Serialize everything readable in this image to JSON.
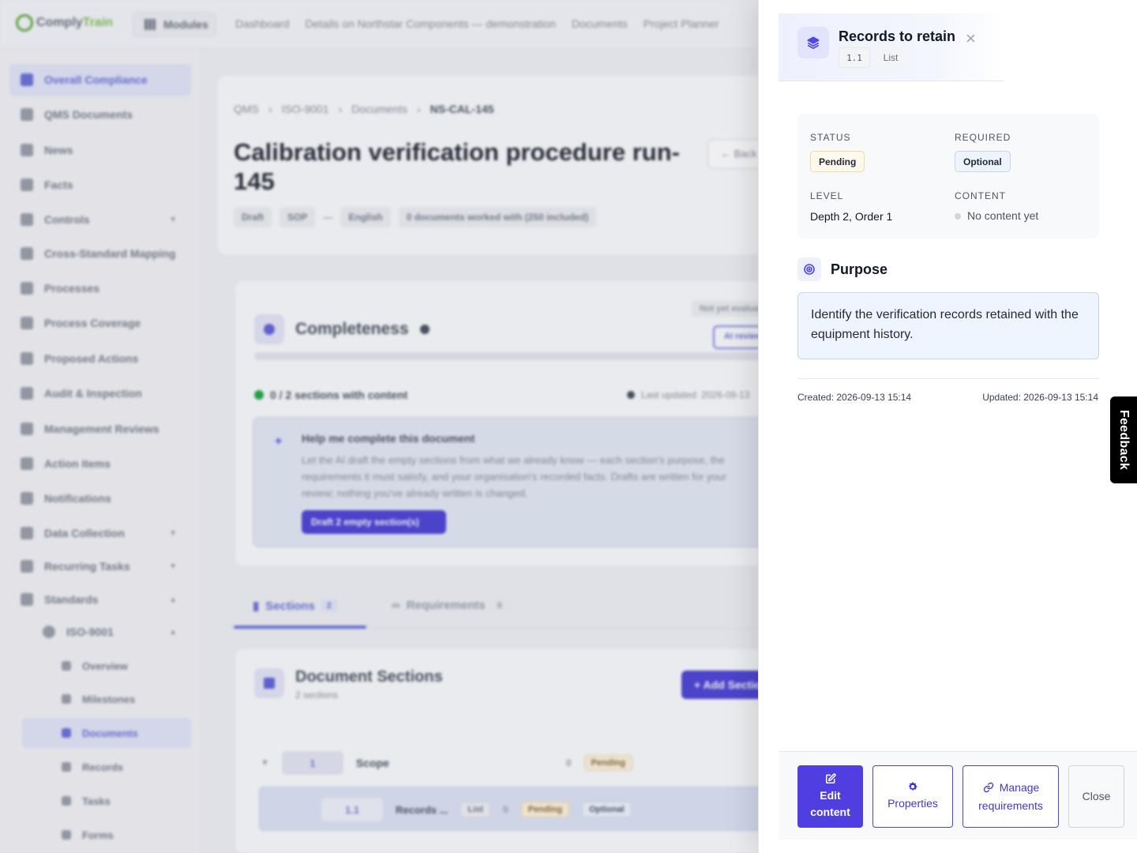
{
  "app": {
    "logo": {
      "part1": "Comply",
      "part2": "Train"
    },
    "modules_label": "Modules",
    "top_nav": [
      "Dashboard",
      "Details on Northstar Components — demonstration",
      "Documents",
      "Project Planner"
    ]
  },
  "sidebar": {
    "items": [
      {
        "label": "Overall Compliance",
        "icon": "compliance-icon",
        "active": true
      },
      {
        "label": "QMS Documents",
        "icon": "document-icon"
      },
      {
        "label": "News",
        "icon": "megaphone-icon"
      },
      {
        "label": "Facts",
        "icon": "lightbulb-icon"
      },
      {
        "label": "Controls",
        "icon": "shield-icon",
        "expandable": true
      },
      {
        "label": "Cross-Standard Mapping",
        "icon": "table-icon"
      },
      {
        "label": "Processes",
        "icon": "flow-icon"
      },
      {
        "label": "Process Coverage",
        "icon": "grid-icon"
      },
      {
        "label": "Proposed Actions",
        "icon": "list-icon"
      },
      {
        "label": "Audit & Inspection",
        "icon": "clipboard-icon"
      },
      {
        "label": "Management Reviews",
        "icon": "chat-icon"
      },
      {
        "label": "Action Items",
        "icon": "checklist-icon"
      },
      {
        "label": "Notifications",
        "icon": "bell-icon"
      },
      {
        "label": "Data Collection",
        "icon": "database-icon",
        "expandable": true
      },
      {
        "label": "Recurring Tasks",
        "icon": "repeat-icon",
        "expandable": true
      },
      {
        "label": "Standards",
        "icon": "book-icon",
        "expanded": true
      }
    ],
    "standard": {
      "label": "ISO-9001",
      "icon": "badge-icon"
    },
    "standard_children": [
      {
        "label": "Overview",
        "icon": "overview-icon"
      },
      {
        "label": "Milestones",
        "icon": "flag-icon"
      },
      {
        "label": "Documents",
        "icon": "folder-icon",
        "active": true
      },
      {
        "label": "Records",
        "icon": "record-icon"
      },
      {
        "label": "Tasks",
        "icon": "task-icon"
      },
      {
        "label": "Forms",
        "icon": "form-icon"
      }
    ]
  },
  "document": {
    "breadcrumb": [
      "QMS",
      "ISO-9001",
      "Documents",
      "NS-CAL-145"
    ],
    "title": "Calibration verification procedure run-145",
    "back_label": "Back",
    "chips": [
      "Draft",
      "SOP",
      "—",
      "English",
      "0 documents worked with (250 included)"
    ]
  },
  "completeness": {
    "title": "Completeness",
    "status": "Not yet evaluated",
    "ai_button": "AI review",
    "sections_with_content": "0 / 2 sections with content",
    "last_updated": "Last updated: 2026-09-13",
    "help_title": "Help me complete this document",
    "help_text": "Let the AI draft the empty sections from what we already know — each section's purpose, the requirements it must satisfy, and your organisation's recorded facts. Drafts are written for your review; nothing you've already written is changed.",
    "draft_button": "Draft 2 empty section(s)"
  },
  "tabs": [
    {
      "label": "Sections",
      "count": "2",
      "active": true
    },
    {
      "label": "Requirements",
      "count": "0"
    }
  ],
  "doc_sections": {
    "title": "Document Sections",
    "subtitle": "2 sections",
    "add_button": "Add Section",
    "rows": [
      {
        "num": "1",
        "title": "Scope",
        "count": "0",
        "status": "Pending"
      },
      {
        "num": "1.1",
        "title": "Records ...",
        "type": "List",
        "count": "0",
        "status": "Pending",
        "required": "Optional"
      }
    ]
  },
  "drawer": {
    "title": "Records to retain",
    "number": "1.1",
    "type": "List",
    "close_icon": "×",
    "meta": {
      "status_label": "STATUS",
      "status": "Pending",
      "required_label": "REQUIRED",
      "required": "Optional",
      "level_label": "LEVEL",
      "level": "Depth 2, Order 1",
      "content_label": "CONTENT",
      "content": "No content yet"
    },
    "purpose_title": "Purpose",
    "purpose_text": "Identify the verification records retained with the equipment history.",
    "created": "Created: 2026-09-13 15:14",
    "updated": "Updated: 2026-09-13 15:14",
    "buttons": {
      "edit": [
        "Edit",
        "content"
      ],
      "properties": "Properties",
      "manage": [
        "Manage",
        "requirements"
      ],
      "close": "Close"
    }
  },
  "feedback_label": "Feedback",
  "colors": {
    "accent": "#4f3fe0",
    "pending_bg": "#fff8ec",
    "optional_bg": "#eef4fb",
    "purpose_bg": "#eef5fe"
  }
}
